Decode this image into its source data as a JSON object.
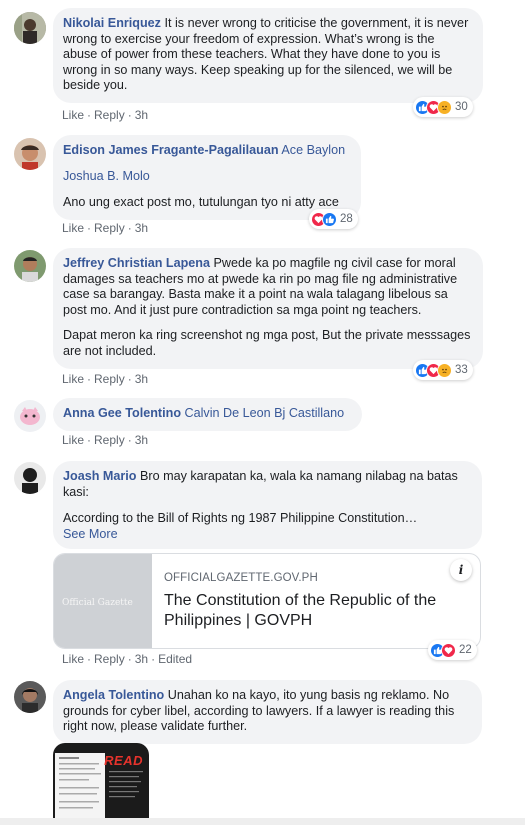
{
  "actions": {
    "like": "Like",
    "reply": "Reply",
    "edited": "Edited"
  },
  "comments": [
    {
      "author": "Nikolai Enriquez",
      "text": "It is never wrong to criticise the government, it is never wrong to exercise your freedom of expression. What’s wrong is the abuse of power from these teachers. What they have done to you is wrong in so many ways. Keep speaking up for the silenced, we will be beside you.",
      "time": "3h",
      "reaction_count": "30"
    },
    {
      "author": "Edison James Fragante-Pagalilauan",
      "mention": "Ace Baylon",
      "mention2": "Joshua B. Molo",
      "text": "Ano ung exact post mo, tutulungan tyo ni atty ace",
      "time": "3h",
      "reaction_count": "28"
    },
    {
      "author": "Jeffrey Christian Lapena",
      "text": "Pwede ka po magfile ng civil case for moral damages sa teachers mo at pwede ka rin po mag file ng administrative case sa barangay. Basta make it a point na wala talagang libelous sa post mo. And it just pure contradiction sa mga point ng teachers.",
      "text2": "Dapat meron ka ring screenshot ng mga post, But the private messsages are not included.",
      "time": "3h",
      "reaction_count": "33"
    },
    {
      "author": "Anna Gee Tolentino",
      "mention": "Calvin De Leon Bj Castillano",
      "time": "3h"
    },
    {
      "author": "Joash Mario",
      "text": "Bro may karapatan ka, wala ka namang nilabag na batas kasi:",
      "text2": "According to the Bill of Rights ng 1987 Philippine Constitution…",
      "see_more": "See More",
      "time": "3h",
      "reaction_count": "22",
      "link": {
        "domain": "OFFICIALGAZETTE.GOV.PH",
        "title": "The Constitution of the Republic of the Philippines | GOVPH",
        "thumb_text": "Official Gazette",
        "info": "i"
      }
    },
    {
      "author": "Angela Tolentino",
      "text": "Unahan ko na kayo, ito yung basis ng reklamo. No grounds for cyber libel, according to lawyers. If a lawyer is reading this right now, please validate further.",
      "image_tag": "READ"
    }
  ]
}
